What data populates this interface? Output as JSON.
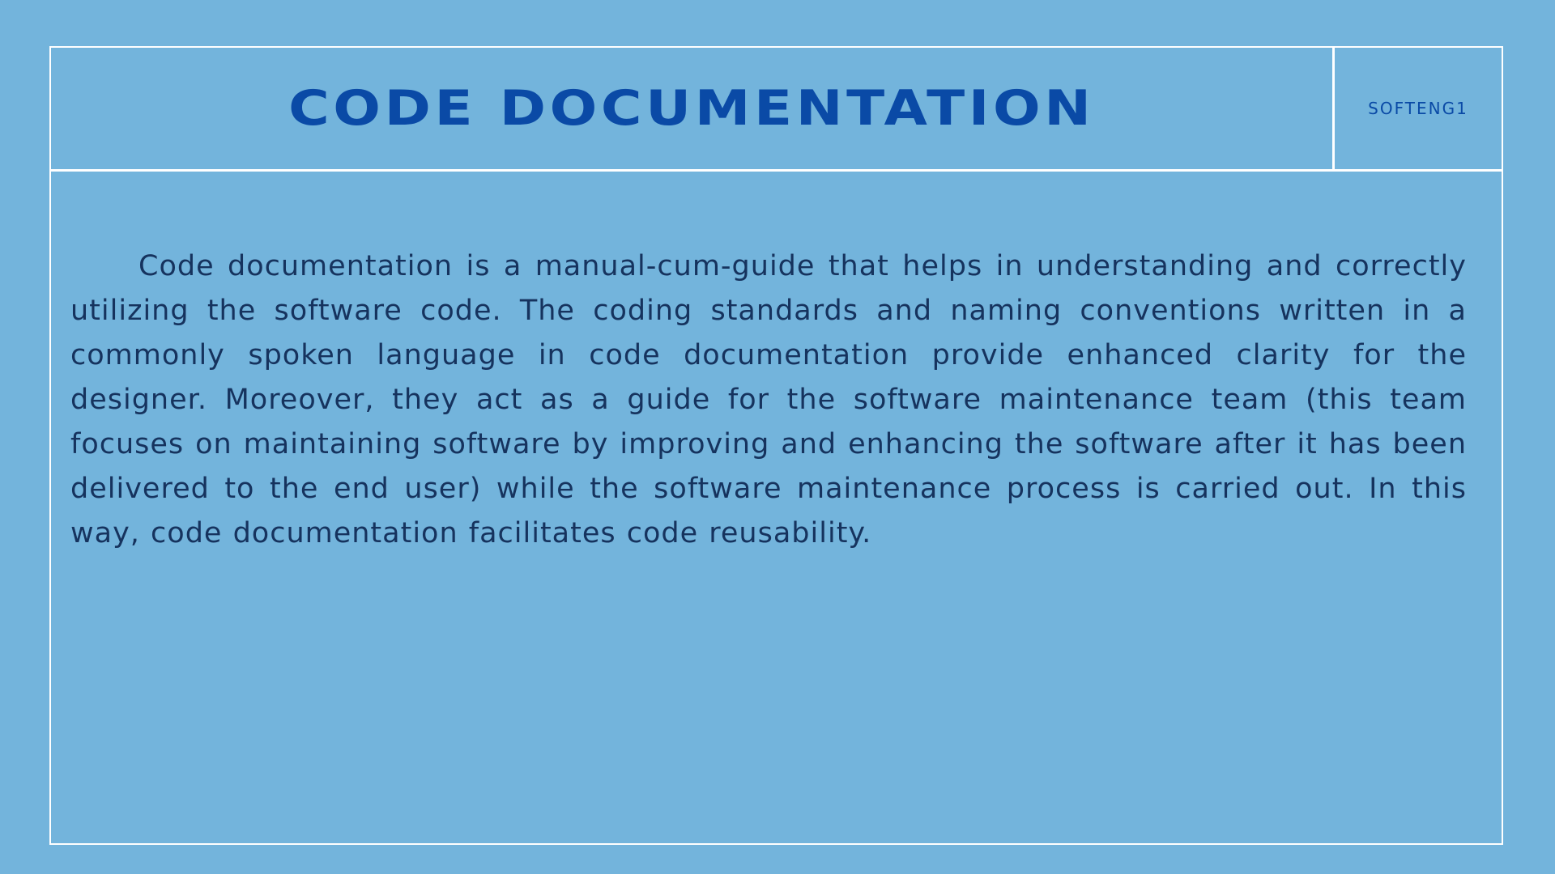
{
  "header": {
    "title": "CODE DOCUMENTATION",
    "course_tag": "SOFTENG1"
  },
  "content": {
    "paragraph": "Code documentation is a manual-cum-guide that helps in understanding and correctly utilizing the software code. The coding standards and naming conventions written in a commonly spoken language in code documentation provide enhanced clarity for the designer. Moreover, they act as a guide for the software maintenance team (this team focuses on maintaining software by improving and enhancing the software after it has been delivered to the end user) while the software maintenance process is carried out. In this way, code documentation facilitates code reusability."
  },
  "colors": {
    "background": "#73b4dc",
    "title": "#0a4aa6",
    "body_text": "#16335e",
    "frame": "#ffffff"
  }
}
